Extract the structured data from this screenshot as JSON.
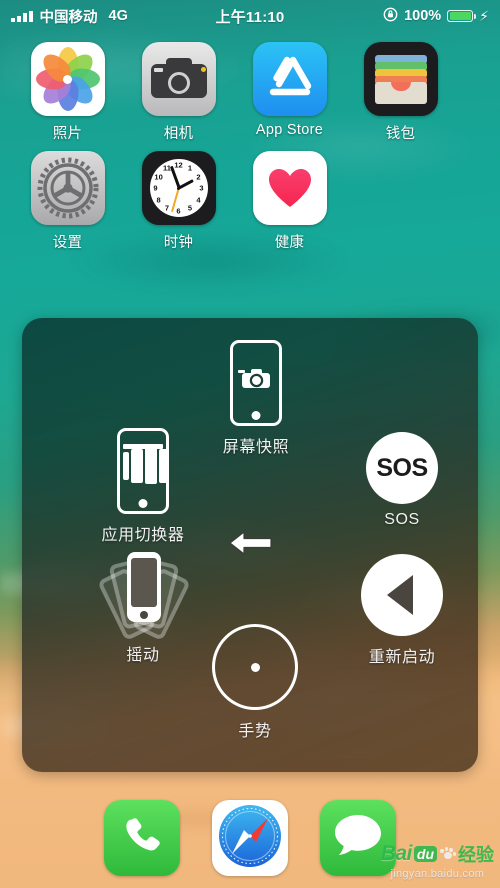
{
  "status_bar": {
    "signal_icon": "signal-bars-icon",
    "carrier": "中国移动",
    "network": "4G",
    "time": "上午11:10",
    "rotation_lock_icon": "rotation-lock-icon",
    "battery_percent": "100%",
    "battery_icon": "battery-full-icon",
    "charging_icon": "⚡",
    "battery_color": "#4cd760"
  },
  "home_screen": {
    "rows": [
      [
        {
          "label": "照片",
          "icon": "photos-icon"
        },
        {
          "label": "相机",
          "icon": "camera-icon"
        },
        {
          "label": "App Store",
          "icon": "app-store-icon"
        },
        {
          "label": "钱包",
          "icon": "wallet-icon"
        }
      ],
      [
        {
          "label": "设置",
          "icon": "settings-icon"
        },
        {
          "label": "时钟",
          "icon": "clock-icon"
        },
        {
          "label": "健康",
          "icon": "health-icon"
        }
      ]
    ]
  },
  "clock_icon": {
    "numbers": [
      "12",
      "1",
      "2",
      "3",
      "4",
      "5",
      "6",
      "7",
      "8",
      "9",
      "10",
      "11"
    ],
    "hour_hand_deg": 62,
    "minute_hand_deg": -20,
    "second_hand_deg": 196
  },
  "assistive_touch": {
    "items": [
      {
        "label": "屏幕快照",
        "icon": "screenshot-icon"
      },
      {
        "label": "应用切换器",
        "icon": "app-switcher-icon"
      },
      {
        "label": "SOS",
        "icon": "sos-icon",
        "glyph": "SOS"
      },
      {
        "label": "摇动",
        "icon": "shake-icon"
      },
      {
        "label": "手势",
        "icon": "gestures-icon"
      },
      {
        "label": "重新启动",
        "icon": "restart-icon"
      }
    ],
    "back_button_icon": "back-arrow-icon"
  },
  "dock": {
    "apps": [
      {
        "name": "phone",
        "icon": "phone-icon"
      },
      {
        "name": "safari",
        "icon": "safari-compass-icon"
      },
      {
        "name": "messages",
        "icon": "messages-bubble-icon"
      }
    ]
  },
  "watermark": {
    "bai": "Bai",
    "du": "du",
    "jingyan": "经验",
    "url": "jingyan.baidu.com",
    "color": "#2db84d"
  }
}
